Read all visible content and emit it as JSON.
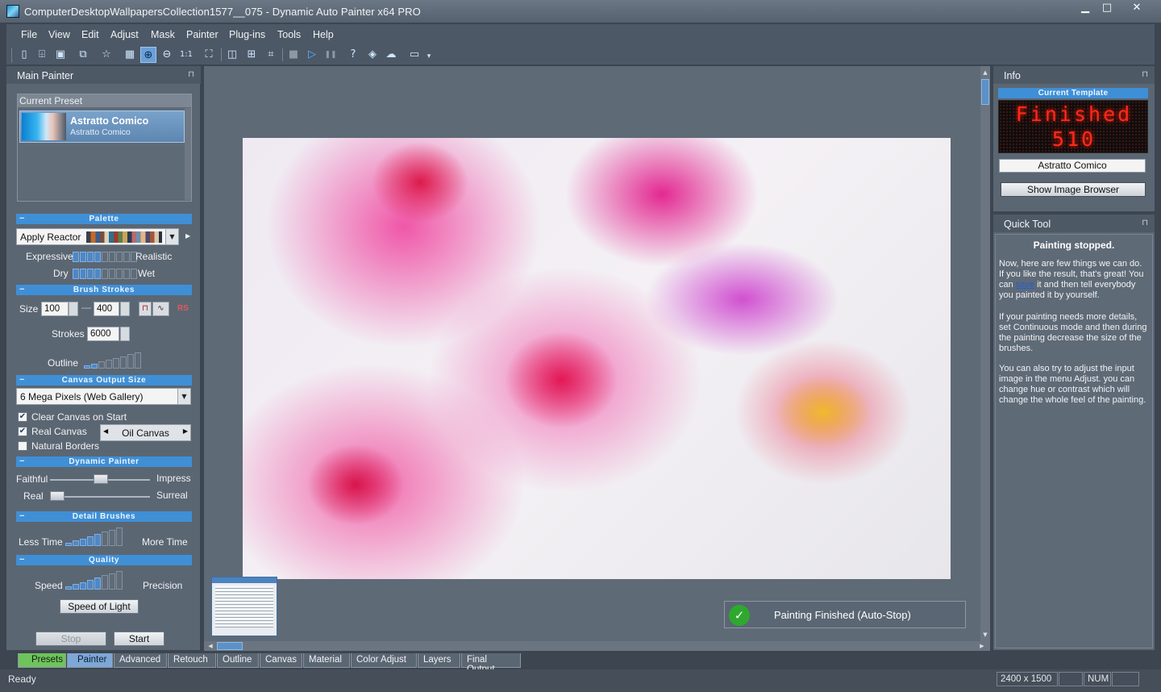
{
  "window": {
    "title": "ComputerDesktopWallpapersCollection1577__075 - Dynamic Auto Painter x64 PRO",
    "controls": {
      "minimize": "▁",
      "maximize": "□",
      "close": "✕"
    }
  },
  "menu": [
    "File",
    "View",
    "Edit",
    "Adjust",
    "Mask",
    "Painter",
    "Plug-ins",
    "Tools",
    "Help"
  ],
  "toolbar": {
    "icons": [
      {
        "name": "new-icon",
        "glyph": "▯"
      },
      {
        "name": "open-icon",
        "glyph": "⌹"
      },
      {
        "name": "save-icon",
        "glyph": "▣"
      },
      {
        "name": "batch-icon",
        "glyph": "⧉"
      },
      {
        "name": "favorite-icon",
        "glyph": "☆"
      },
      {
        "name": "image-browser-icon",
        "glyph": "▦"
      },
      {
        "name": "zoom-in-icon",
        "glyph": "⊕"
      },
      {
        "name": "zoom-out-icon",
        "glyph": "⊖"
      },
      {
        "name": "actual-size-icon",
        "glyph": "1:1"
      },
      {
        "name": "fit-icon",
        "glyph": "⛶"
      },
      {
        "name": "split-view-icon",
        "glyph": "◫"
      },
      {
        "name": "compare-icon",
        "glyph": "⊞"
      },
      {
        "name": "crop-icon",
        "glyph": "⌗"
      },
      {
        "name": "stop-icon",
        "glyph": "■"
      },
      {
        "name": "play-icon",
        "glyph": "▷"
      },
      {
        "name": "pause-icon",
        "glyph": "❚❚"
      },
      {
        "name": "help-icon",
        "glyph": "?"
      },
      {
        "name": "layers-icon",
        "glyph": "◈"
      },
      {
        "name": "upload-icon",
        "glyph": "☁"
      },
      {
        "name": "fullscreen-icon",
        "glyph": "▭"
      },
      {
        "name": "toolbar-options-icon",
        "glyph": "▾"
      }
    ]
  },
  "left_panel": {
    "title": "Main Painter",
    "pin": "⊓",
    "current_preset_label": "Current Preset",
    "preset_name": "Astratto Comico",
    "preset_sub": "Astratto Comico",
    "sections": {
      "palette": "Palette",
      "brush": "Brush Strokes",
      "canvas": "Canvas Output Size",
      "dynamic": "Dynamic Painter",
      "detail": "Detail Brushes",
      "quality": "Quality"
    },
    "palette": {
      "combo": "Apply Reactor",
      "expressive": "Expressive",
      "realistic": "Realistic",
      "dry": "Dry",
      "wet": "Wet",
      "expressive_level": 4,
      "dry_level": 4
    },
    "brush": {
      "size_label": "Size",
      "size_min": "100",
      "dash": "—",
      "size_max": "400",
      "rs": "RS",
      "strokes_label": "Strokes",
      "strokes": "6000",
      "outline_label": "Outline",
      "outline_level": 2
    },
    "canvas": {
      "output": "6 Mega Pixels (Web Gallery)",
      "clear": "Clear Canvas on Start",
      "clear_checked": true,
      "real": "Real Canvas",
      "real_checked": true,
      "canvas_type": "Oil Canvas",
      "natural": "Natural Borders",
      "natural_checked": false
    },
    "dynamic": {
      "faithful": "Faithful",
      "impress": "Impress",
      "real": "Real",
      "surreal": "Surreal",
      "faithful_value": 0.51,
      "real_value": 0.0
    },
    "detail": {
      "less": "Less Time",
      "more": "More Time",
      "level": 5
    },
    "quality": {
      "speed": "Speed",
      "precision": "Precision",
      "level": 5,
      "preset_button": "Speed of Light"
    },
    "stop": "Stop",
    "start": "Start"
  },
  "canvas_view": {
    "toast": "Painting Finished (Auto-Stop)"
  },
  "info_panel": {
    "title": "Info",
    "current_template": "Current Template",
    "led_line1": "Finished",
    "led_line2": "510",
    "template_name": "Astratto Comico",
    "show_browser": "Show Image Browser"
  },
  "quick_tool": {
    "title": "Quick Tool",
    "heading": "Painting stopped.",
    "p1_before": "Now, here are few things we can do. If you like the result, that's great! You can ",
    "p1_link": "save",
    "p1_after": " it and then tell everybody you painted it by yourself.",
    "p2": "If your painting needs more details, set Continuous mode and then during the painting decrease the size of the brushes.",
    "p3": "You can also try to adjust the input image in the menu Adjust. you can change hue or contrast which will change the whole feel of the painting."
  },
  "tabs": [
    "Presets",
    "Painter",
    "Advanced",
    "Retouch",
    "Outline",
    "Canvas",
    "Material",
    "Color Adjust",
    "Layers",
    "Final Output"
  ],
  "status": {
    "text": "Ready",
    "size": "2400 x 1500",
    "num": "NUM"
  },
  "colors": {
    "accent": "#3f8fd6",
    "selected_tab": "#6fc35c",
    "led": "#ff2a1c"
  }
}
